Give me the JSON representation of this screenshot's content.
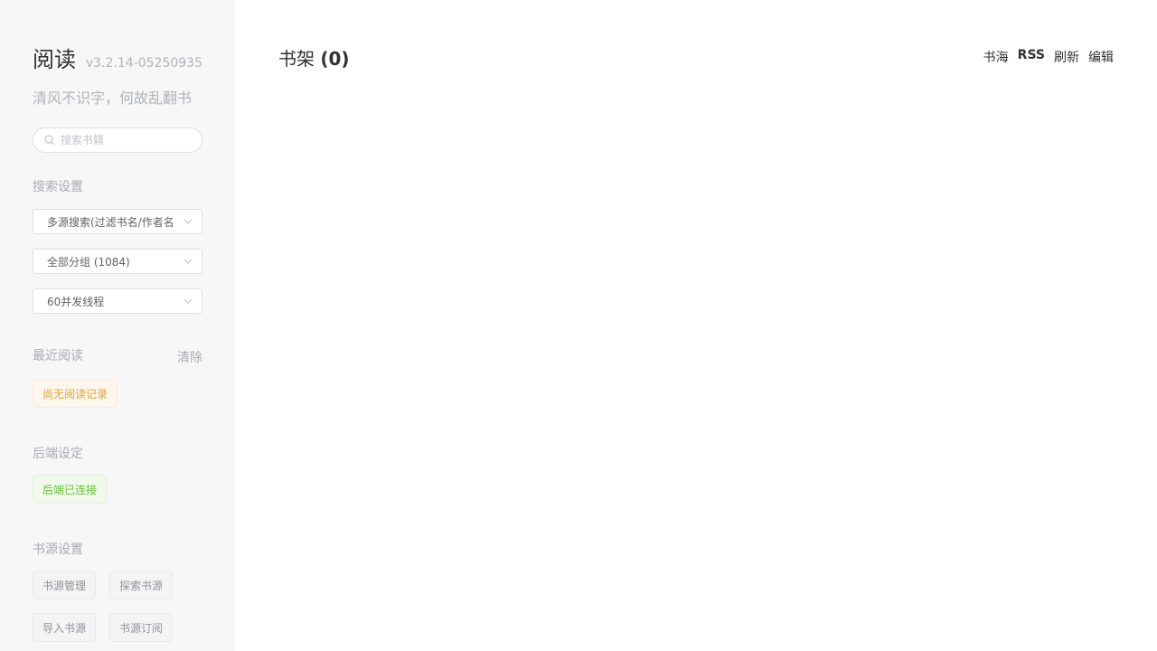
{
  "sidebar": {
    "title": "阅读",
    "version": "v3.2.14-05250935",
    "slogan": "清风不识字，何故乱翻书",
    "search_placeholder": "搜索书籍",
    "search_settings": {
      "label": "搜索设置",
      "mode_select": "多源搜索(过滤书名/作者名)",
      "group_select": "全部分组 (1084)",
      "thread_select": "60并发线程"
    },
    "recent": {
      "label": "最近阅读",
      "clear": "清除",
      "empty": "尚无阅读记录"
    },
    "backend": {
      "label": "后端设定",
      "status": "后端已连接"
    },
    "sources": {
      "label": "书源设置",
      "buttons": [
        "书源管理",
        "探索书源",
        "导入书源",
        "书源订阅"
      ]
    }
  },
  "main": {
    "title": "书架",
    "count": "(0)",
    "actions": [
      "书海",
      "RSS",
      "刷新",
      "编辑"
    ]
  },
  "colors": {
    "sidebar_bg": "#f7f7f7",
    "warning": "#e6a23c",
    "success": "#67c23a"
  }
}
